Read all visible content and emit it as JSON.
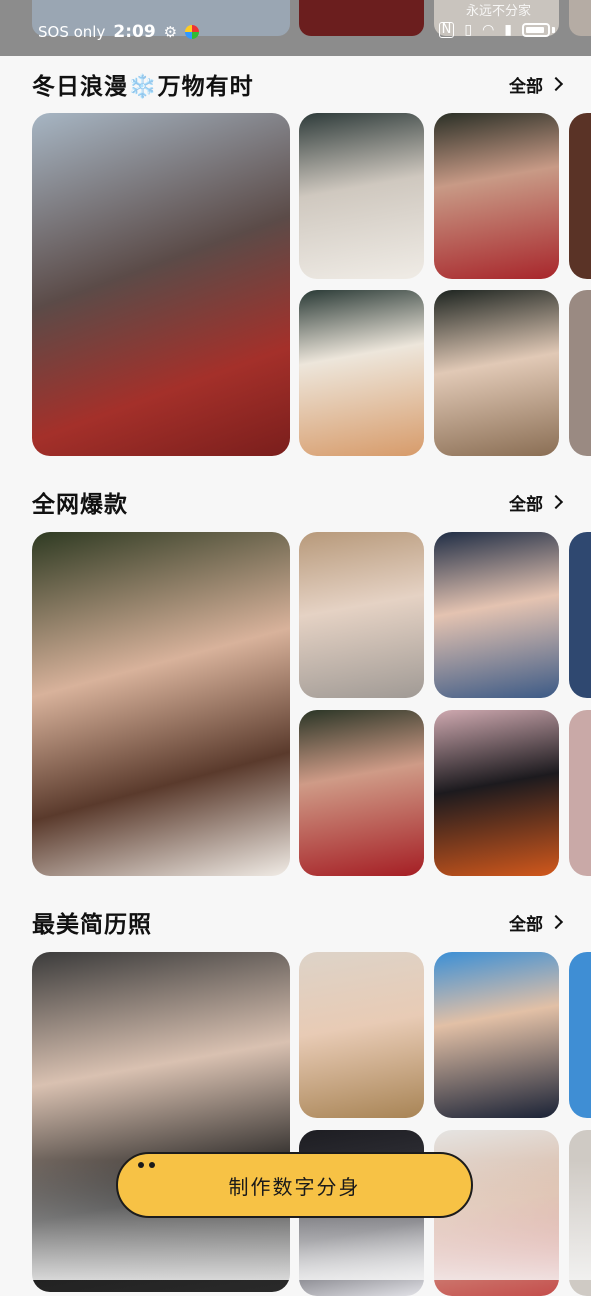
{
  "status_bar": {
    "carrier": "SOS only",
    "time": "2:09",
    "watermark": "永远不分家"
  },
  "sections": [
    {
      "title": "冬日浪漫",
      "title_emoji": "❄️",
      "title_suffix": "万物有时",
      "see_all": "全部",
      "colors": [
        "#7a3b33",
        "#b83c33",
        "#b43a36",
        "#c9b9a8",
        "#7d6a57"
      ]
    },
    {
      "title": "全网爆款",
      "see_all": "全部",
      "colors": [
        "#7a3a2a",
        "#c9a98c",
        "#3b5274",
        "#5a2c22",
        "#b58b95"
      ]
    },
    {
      "title": "最美简历照",
      "see_all": "全部",
      "colors": [
        "#2c2c2c",
        "#b8a07a",
        "#2c3e66",
        "#1f2430",
        "#d9d4cf"
      ]
    }
  ],
  "cta": {
    "label": "制作数字分身"
  }
}
